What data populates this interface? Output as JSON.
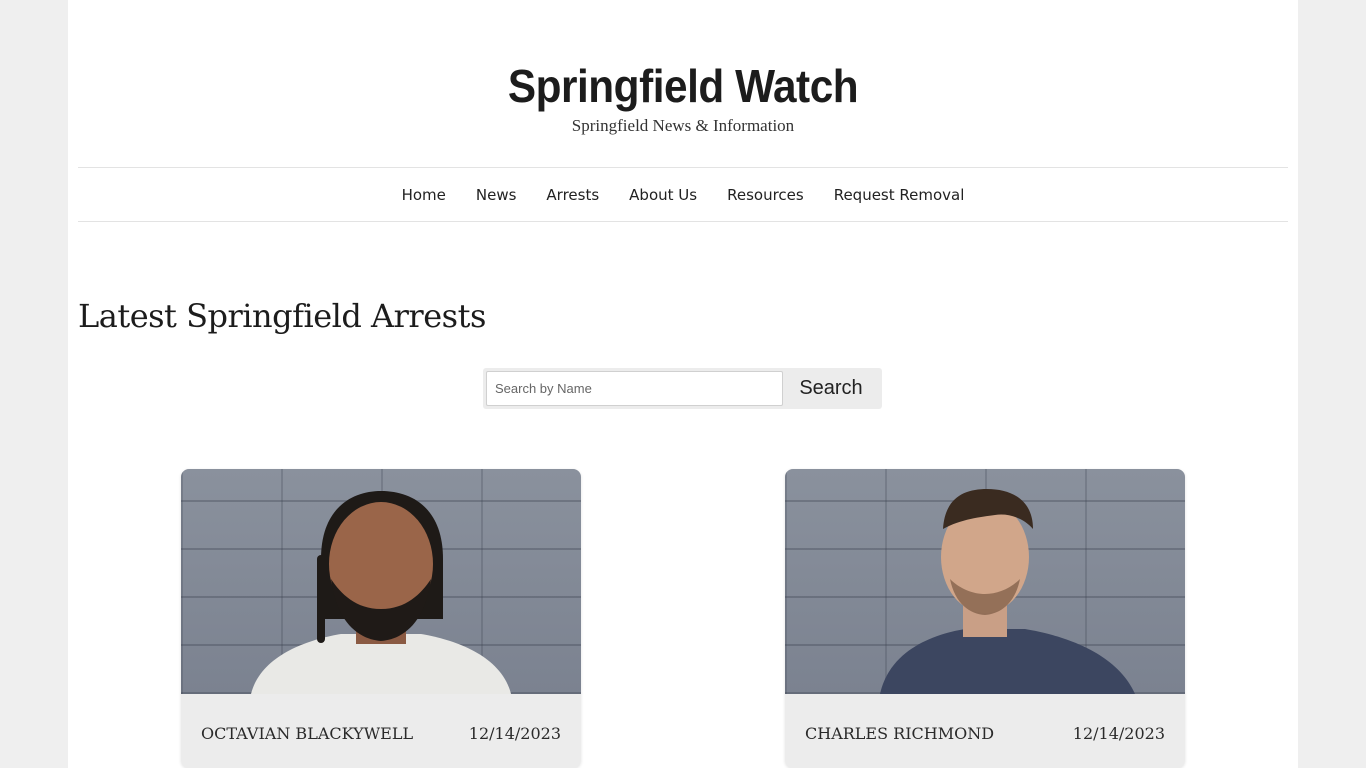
{
  "header": {
    "title": "Springfield Watch",
    "tagline": "Springfield News & Information"
  },
  "nav": {
    "items": [
      "Home",
      "News",
      "Arrests",
      "About Us",
      "Resources",
      "Request Removal"
    ]
  },
  "main": {
    "heading": "Latest Springfield Arrests",
    "search": {
      "placeholder": "Search by Name",
      "value": "",
      "button_label": "Search"
    },
    "arrests": [
      {
        "name": "OCTAVIAN BLACKYWELL",
        "date": "12/14/2023"
      },
      {
        "name": "CHARLES RICHMOND",
        "date": "12/14/2023"
      }
    ]
  },
  "colors": {
    "page_bg": "#efefef",
    "content_bg": "#ffffff",
    "card_bg": "#ececec",
    "text": "#1c1c1c"
  }
}
